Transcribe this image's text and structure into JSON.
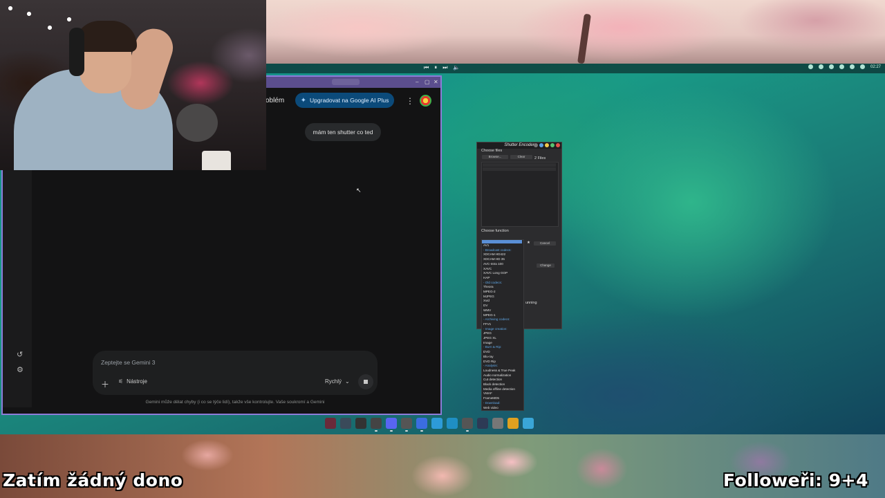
{
  "overlay": {
    "left_text": "Zatím žádný dono",
    "right_text": "Followeři: 9+4"
  },
  "gemini": {
    "header_text": "oblém",
    "upgrade_button": "Upgradovat na Google AI Plus",
    "user_message": "mám ten shutter co ted",
    "prompt_placeholder": "Zeptejte se Gemini 3",
    "tools_label": "Nástroje",
    "speed_label": "Rychlý",
    "disclaimer": "Gemini může dělat chyby (i co se týče lidí), takže vše kontrolujte. Vaše soukromí a Gemini"
  },
  "shutter_encoder": {
    "title": "Shutter Encoder",
    "choose_files": "Choose files",
    "browse": "Browse...",
    "clear": "Clear",
    "file_count": "2 Files",
    "choose_function": "Choose function",
    "cancel": "Cancel",
    "change": "Change",
    "running": "unning",
    "dropdown": [
      {
        "label": "AV1",
        "cat": false
      },
      {
        "label": "- Broadcast codecs:",
        "cat": true
      },
      {
        "label": "XDCAM HD422",
        "cat": false
      },
      {
        "label": "XDCAM HD 35",
        "cat": false
      },
      {
        "label": "AVC-Intra 100",
        "cat": false
      },
      {
        "label": "XAVC",
        "cat": false
      },
      {
        "label": "XAVC Long GOP",
        "cat": false
      },
      {
        "label": "HAP",
        "cat": false
      },
      {
        "label": "- Old codecs:",
        "cat": true
      },
      {
        "label": "Theora",
        "cat": false
      },
      {
        "label": "MPEG-2",
        "cat": false
      },
      {
        "label": "MJPEG",
        "cat": false
      },
      {
        "label": "Xvid",
        "cat": false
      },
      {
        "label": "DV",
        "cat": false
      },
      {
        "label": "WMV",
        "cat": false
      },
      {
        "label": "MPEG-1",
        "cat": false
      },
      {
        "label": "- Archiving codecs:",
        "cat": true
      },
      {
        "label": "FFV1",
        "cat": false
      },
      {
        "label": "- Image creation:",
        "cat": true
      },
      {
        "label": "JPEG",
        "cat": false
      },
      {
        "label": "JPEG XL",
        "cat": false
      },
      {
        "label": "Image",
        "cat": false
      },
      {
        "label": "- Burn & Rip:",
        "cat": true
      },
      {
        "label": "DVD",
        "cat": false
      },
      {
        "label": "Blu-ray",
        "cat": false
      },
      {
        "label": "DVD Rip",
        "cat": false
      },
      {
        "label": "- Analysis:",
        "cat": true
      },
      {
        "label": "Loudness & True Peak",
        "cat": false
      },
      {
        "label": "Audio normalization",
        "cat": false
      },
      {
        "label": "Cut detection",
        "cat": false
      },
      {
        "label": "Black detection",
        "cat": false
      },
      {
        "label": "Media offline detection",
        "cat": false
      },
      {
        "label": "VMAF",
        "cat": false
      },
      {
        "label": "FrameMD5",
        "cat": false
      },
      {
        "label": "- Download:",
        "cat": true
      },
      {
        "label": "Web video",
        "cat": false
      }
    ]
  },
  "system": {
    "clock": "02:27"
  },
  "taskbar_icons": [
    "terminal-icon",
    "monitor-icon",
    "panel-icon",
    "obs-icon",
    "discord-icon",
    "chrome-icon",
    "dropbox-icon",
    "files-icon",
    "vscode-icon",
    "keyboard-icon",
    "console-icon",
    "settings-icon",
    "apps-grid-icon",
    "screenshot-icon"
  ]
}
